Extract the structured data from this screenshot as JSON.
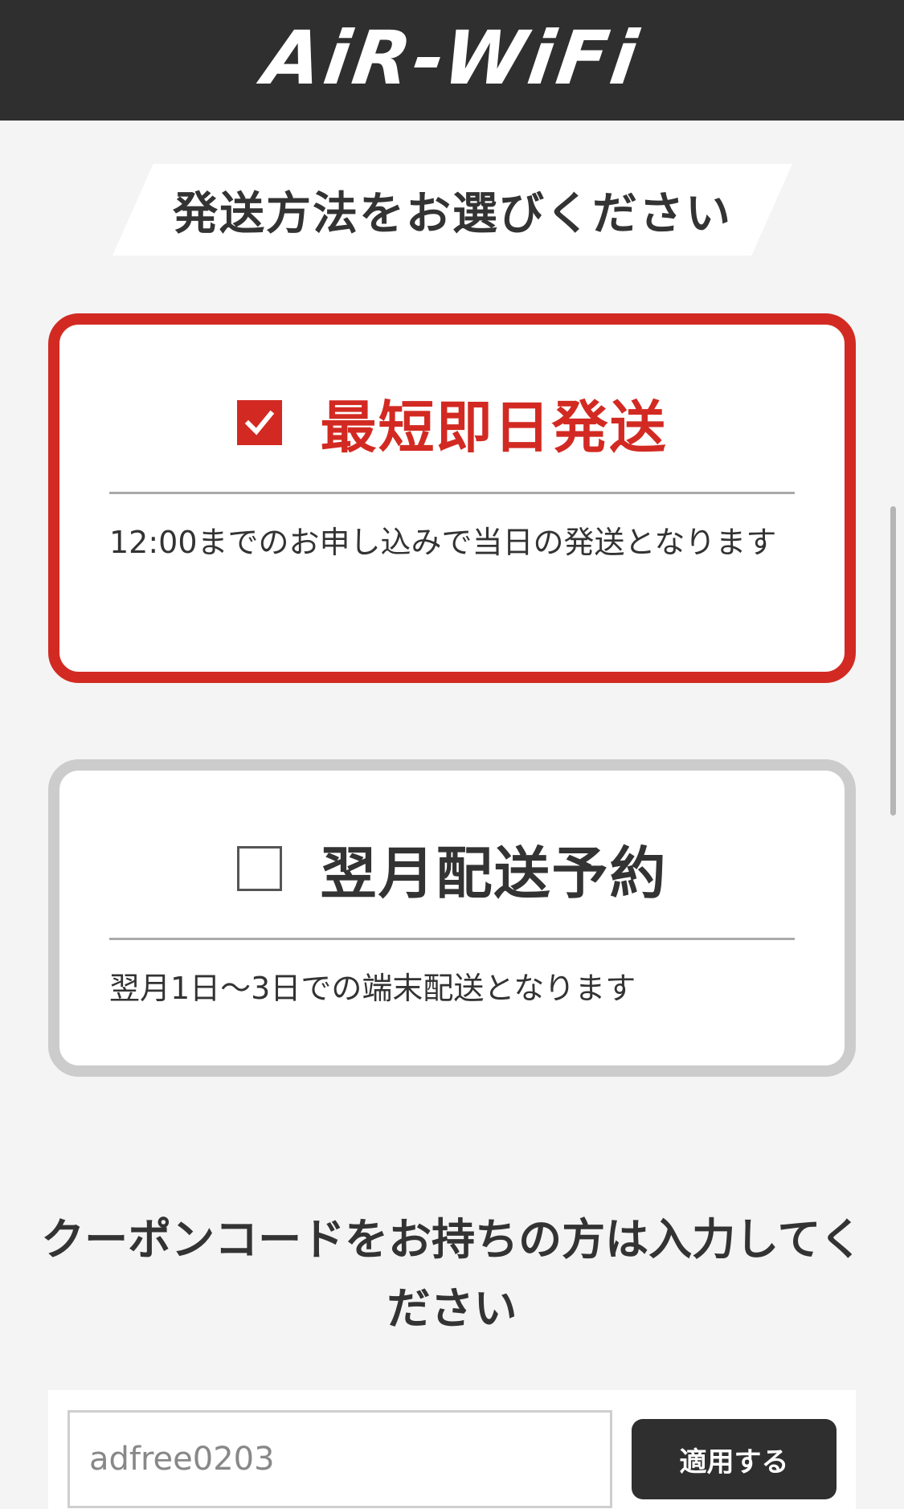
{
  "header": {
    "logo_text": "AiR-WiFi"
  },
  "shipping": {
    "section_title": "発送方法をお選びください",
    "options": [
      {
        "title": "最短即日発送",
        "description": "12:00までのお申し込みで当日の発送となります",
        "selected": true
      },
      {
        "title": "翌月配送予約",
        "description": "翌月1日〜3日での端末配送となります",
        "selected": false
      }
    ]
  },
  "coupon": {
    "heading": "クーポンコードをお持ちの方は入力してください",
    "input_value": "adfree0203",
    "apply_label": "適用する"
  },
  "colors": {
    "accent": "#d22a22",
    "header_bg": "#2f2f2f",
    "page_bg": "#f4f4f4",
    "unselected_border": "#cccccc"
  },
  "icons": {
    "checked": "checkbox-checked-icon",
    "unchecked": "checkbox-unchecked-icon"
  }
}
